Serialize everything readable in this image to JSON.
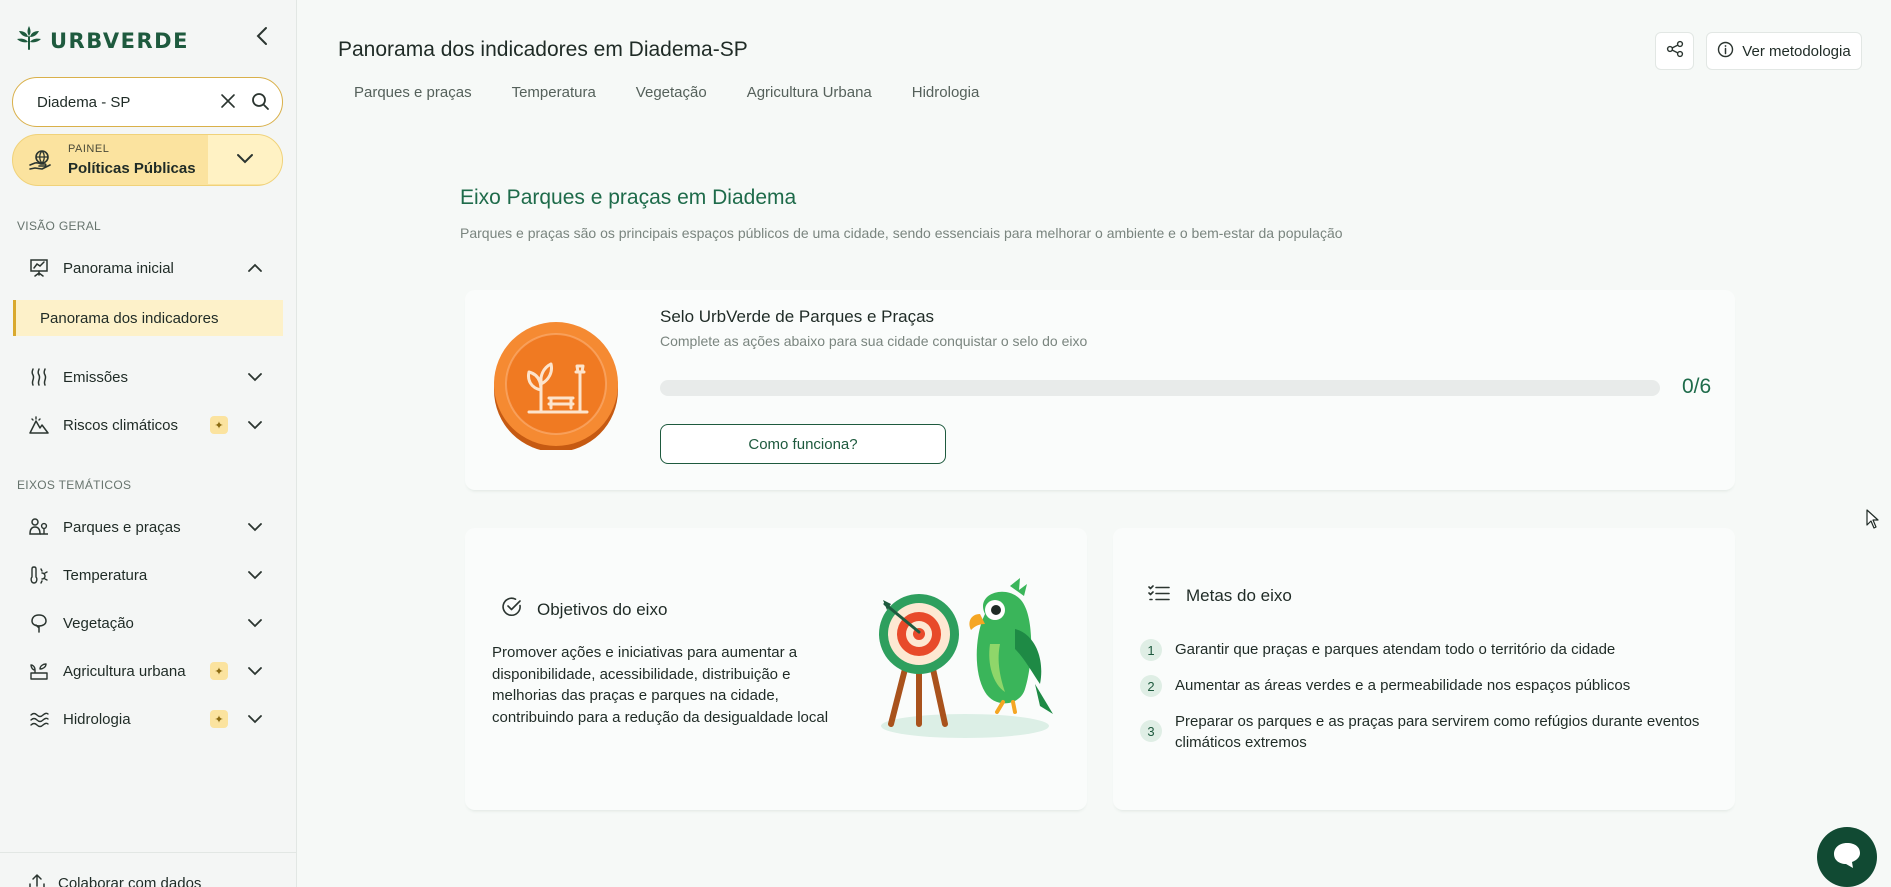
{
  "brand": {
    "name": "URBVERDE"
  },
  "search": {
    "value": "Diadema - SP"
  },
  "painel": {
    "label": "PAINEL",
    "value": "Políticas Públicas"
  },
  "sidebar": {
    "overview_label": "VISÃO GERAL",
    "themes_label": "EIXOS TEMÁTICOS",
    "overview_items": [
      {
        "label": "Panorama inicial",
        "icon": "presentation-chart-icon",
        "expanded": true
      },
      {
        "label": "Emissões",
        "icon": "heat-waves-icon"
      },
      {
        "label": "Riscos climáticos",
        "icon": "mountain-alert-icon",
        "badge": "sparkle"
      }
    ],
    "active_subitem": "Panorama dos indicadores",
    "theme_items": [
      {
        "label": "Parques e praças",
        "icon": "people-park-icon"
      },
      {
        "label": "Temperatura",
        "icon": "thermometer-sun-icon"
      },
      {
        "label": "Vegetação",
        "icon": "tree-icon"
      },
      {
        "label": "Agricultura urbana",
        "icon": "seedling-icon",
        "badge": "sparkle"
      },
      {
        "label": "Hidrologia",
        "icon": "water-waves-icon",
        "badge": "sparkle"
      }
    ],
    "footer_item": "Colaborar com dados"
  },
  "header": {
    "title": "Panorama dos indicadores em Diadema-SP",
    "tabs": [
      "Parques e praças",
      "Temperatura",
      "Vegetação",
      "Agricultura Urbana",
      "Hidrologia"
    ],
    "methodology_label": "Ver metodologia"
  },
  "axis": {
    "title": "Eixo Parques e praças em Diadema",
    "subtitle": "Parques e praças são os principais espaços públicos de uma cidade, sendo essenciais para melhorar o ambiente e o bem-estar da população"
  },
  "seal": {
    "title": "Selo UrbVerde de Parques e Praças",
    "subtitle": "Complete as ações abaixo para sua cidade conquistar o selo do eixo",
    "completed": 0,
    "total": 6,
    "count_label": "0/6",
    "progress_fraction": 0,
    "button_label": "Como funciona?"
  },
  "objectives": {
    "title": "Objetivos do eixo",
    "text": "Promover ações e iniciativas para aumentar a disponibilidade, acessibilidade, distribuição e melhorias das praças e parques na cidade, contribuindo para a redução da desigualdade local"
  },
  "goals": {
    "title": "Metas do eixo",
    "items": [
      {
        "num": "1",
        "text": "Garantir que praças e parques atendam todo o território da cidade"
      },
      {
        "num": "2",
        "text": "Aumentar as áreas verdes e a permeabilidade nos espaços públicos"
      },
      {
        "num": "3",
        "text": "Preparar os parques e as praças para servirem como refúgios durante eventos climáticos extremos"
      }
    ]
  },
  "colors": {
    "brand_green": "#1e5a3e",
    "accent_yellow": "#fbe39f",
    "seal_orange": "#f07f2a",
    "chat": "#114a33"
  }
}
